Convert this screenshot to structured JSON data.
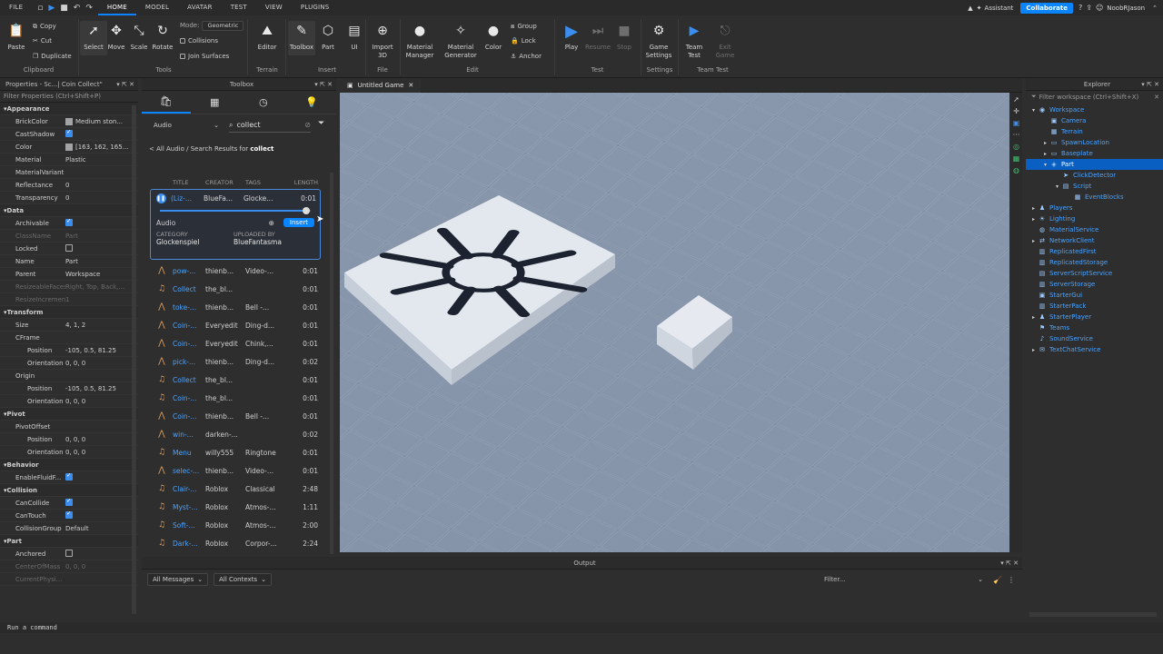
{
  "menu": {
    "file": "FILE",
    "tabs": [
      "HOME",
      "MODEL",
      "AVATAR",
      "TEST",
      "VIEW",
      "PLUGINS"
    ],
    "assistant": "Assistant",
    "collaborate": "Collaborate",
    "user": "NoobRJason"
  },
  "ribbon": {
    "paste": "Paste",
    "copy": "Copy",
    "cut": "Cut",
    "duplicate": "Duplicate",
    "clipboard": "Clipboard",
    "select": "Select",
    "move": "Move",
    "scale": "Scale",
    "rotate": "Rotate",
    "mode_label": "Mode:",
    "mode_value": "Geometric",
    "collisions": "Collisions",
    "join_surfaces": "Join Surfaces",
    "tools": "Tools",
    "editor": "Editor",
    "toolbox": "Toolbox",
    "terrain": "Terrain",
    "part": "Part",
    "ui": "UI",
    "import3d_line1": "Import",
    "import3d_line2": "3D",
    "insert": "Insert",
    "file": "File",
    "material_manager_line1": "Material",
    "material_manager_line2": "Manager",
    "material_generator_line1": "Material",
    "material_generator_line2": "Generator",
    "color": "Color",
    "group": "Group",
    "lock": "Lock",
    "anchor": "Anchor",
    "edit": "Edit",
    "play": "Play",
    "resume": "Resume",
    "stop": "Stop",
    "test": "Test",
    "game_settings_line1": "Game",
    "game_settings_line2": "Settings",
    "settings": "Settings",
    "team_test_line1": "Team",
    "team_test_line2": "Test",
    "exit_game_line1": "Exit",
    "exit_game_line2": "Game",
    "team_test_group": "Team Test"
  },
  "properties": {
    "title": "Properties - Sc...| Coin Collect\"",
    "filter": "Filter Properties (Ctrl+Shift+P)",
    "rows": [
      {
        "type": "sec",
        "name": "Appearance"
      },
      {
        "name": "BrickColor",
        "value": "Medium ston...",
        "swatch": "#a3a2a5"
      },
      {
        "name": "CastShadow",
        "check": true
      },
      {
        "name": "Color",
        "value": "[163, 162, 165...",
        "swatch": "#a3a2a5"
      },
      {
        "name": "Material",
        "value": "Plastic"
      },
      {
        "name": "MaterialVariant",
        "value": ""
      },
      {
        "name": "Reflectance",
        "value": "0"
      },
      {
        "name": "Transparency",
        "value": "0"
      },
      {
        "type": "sec",
        "name": "Data"
      },
      {
        "name": "Archivable",
        "check": true
      },
      {
        "name": "ClassName",
        "value": "Part",
        "dim": true
      },
      {
        "name": "Locked",
        "check": false
      },
      {
        "name": "Name",
        "value": "Part"
      },
      {
        "name": "Parent",
        "value": "Workspace"
      },
      {
        "name": "ResizeableFaces",
        "value": "Right, Top, Back,...",
        "dim": true
      },
      {
        "name": "ResizeIncrement",
        "value": "1",
        "dim": true
      },
      {
        "type": "sec",
        "name": "Transform"
      },
      {
        "name": "Size",
        "value": "4, 1, 2"
      },
      {
        "name": "CFrame",
        "value": ""
      },
      {
        "name": "Position",
        "value": "-105, 0.5, 81.25",
        "sub": true
      },
      {
        "name": "Orientation",
        "value": "0, 0, 0",
        "sub": true
      },
      {
        "name": "Origin",
        "value": ""
      },
      {
        "name": "Position",
        "value": "-105, 0.5, 81.25",
        "sub": true
      },
      {
        "name": "Orientation",
        "value": "0, 0, 0",
        "sub": true
      },
      {
        "type": "sec",
        "name": "Pivot"
      },
      {
        "name": "PivotOffset",
        "value": ""
      },
      {
        "name": "Position",
        "value": "0, 0, 0",
        "sub": true
      },
      {
        "name": "Orientation",
        "value": "0, 0, 0",
        "sub": true
      },
      {
        "type": "sec",
        "name": "Behavior"
      },
      {
        "name": "EnableFluidF...",
        "check": true
      },
      {
        "type": "sec",
        "name": "Collision"
      },
      {
        "name": "CanCollide",
        "check": true
      },
      {
        "name": "CanTouch",
        "check": true
      },
      {
        "name": "CollisionGroup",
        "value": "Default"
      },
      {
        "type": "sec",
        "name": "Part"
      },
      {
        "name": "Anchored",
        "check": false
      },
      {
        "name": "CenterOfMass",
        "value": "0, 0, 0",
        "dim": true
      },
      {
        "name": "CurrentPhysi...",
        "value": "",
        "dim": true
      }
    ]
  },
  "toolbox": {
    "title": "Toolbox",
    "category": "Audio",
    "search": "collect",
    "breadcrumb_prefix": "< All Audio / Search Results for ",
    "breadcrumb_term": "collect",
    "columns": {
      "title": "TITLE",
      "creator": "CREATOR",
      "tags": "TAGS",
      "length": "LENGTH"
    },
    "selected": {
      "title": "(Liz-...",
      "creator": "BlueFa...",
      "tags": "Glocke...",
      "length": "0:01",
      "type": "Audio",
      "insert": "Insert",
      "category_label": "CATEGORY",
      "category_value": "Glockenspiel",
      "uploaded_label": "UPLOADED BY",
      "uploaded_value": "BlueFantasma"
    },
    "rows": [
      {
        "icon": "waveform",
        "title": "pow-...",
        "creator": "thienb...",
        "tags": "Video-...",
        "length": "0:01"
      },
      {
        "icon": "music",
        "title": "Collect",
        "creator": "the_bl...",
        "tags": "",
        "length": "0:01"
      },
      {
        "icon": "waveform",
        "title": "toke-...",
        "creator": "thienb...",
        "tags": "Bell -...",
        "length": "0:01"
      },
      {
        "icon": "waveform",
        "title": "Coin-...",
        "creator": "Everyedit",
        "tags": "Ding-d...",
        "length": "0:01"
      },
      {
        "icon": "waveform",
        "title": "Coin-...",
        "creator": "Everyedit",
        "tags": "Chink,...",
        "length": "0:01"
      },
      {
        "icon": "waveform",
        "title": "pick-...",
        "creator": "thienb...",
        "tags": "Ding-d...",
        "length": "0:02"
      },
      {
        "icon": "music",
        "title": "Collect",
        "creator": "the_bl...",
        "tags": "",
        "length": "0:01"
      },
      {
        "icon": "music",
        "title": "Coin-...",
        "creator": "the_bl...",
        "tags": "",
        "length": "0:01"
      },
      {
        "icon": "waveform",
        "title": "Coin-...",
        "creator": "thienb...",
        "tags": "Bell -...",
        "length": "0:01"
      },
      {
        "icon": "waveform",
        "title": "win-...",
        "creator": "darken-...",
        "tags": "",
        "length": "0:02"
      },
      {
        "icon": "music",
        "title": "Menu",
        "creator": "willy555",
        "tags": "Ringtone",
        "length": "0:01"
      },
      {
        "icon": "waveform",
        "title": "selec-...",
        "creator": "thienb...",
        "tags": "Video-...",
        "length": "0:01"
      },
      {
        "icon": "music",
        "title": "Clair-...",
        "creator": "Roblox",
        "tags": "Classical",
        "length": "2:48"
      },
      {
        "icon": "music",
        "title": "Myst-...",
        "creator": "Roblox",
        "tags": "Atmos-...",
        "length": "1:11"
      },
      {
        "icon": "music",
        "title": "Soft-...",
        "creator": "Roblox",
        "tags": "Atmos-...",
        "length": "2:00"
      },
      {
        "icon": "music",
        "title": "Dark-...",
        "creator": "Roblox",
        "tags": "Corpor-...",
        "length": "2:24"
      }
    ]
  },
  "viewport": {
    "tab": "Untitled Game"
  },
  "explorer": {
    "title": "Explorer",
    "filter": "Filter workspace (Ctrl+Shift+X)",
    "items": [
      {
        "label": "Workspace",
        "depth": 0,
        "arrow": "▾",
        "icon": "◉"
      },
      {
        "label": "Camera",
        "depth": 1,
        "arrow": "",
        "icon": "▣"
      },
      {
        "label": "Terrain",
        "depth": 1,
        "arrow": "",
        "icon": "▦"
      },
      {
        "label": "SpawnLocation",
        "depth": 1,
        "arrow": "▸",
        "icon": "▭"
      },
      {
        "label": "Baseplate",
        "depth": 1,
        "arrow": "▸",
        "icon": "▭"
      },
      {
        "label": "Part",
        "depth": 1,
        "arrow": "▾",
        "icon": "◈",
        "selected": true
      },
      {
        "label": "ClickDetector",
        "depth": 2,
        "arrow": "",
        "icon": "➤"
      },
      {
        "label": "Script",
        "depth": 2,
        "arrow": "▾",
        "icon": "▤"
      },
      {
        "label": "EventBlocks",
        "depth": 3,
        "arrow": "",
        "icon": "▦"
      },
      {
        "label": "Players",
        "depth": 0,
        "arrow": "▸",
        "icon": "♟"
      },
      {
        "label": "Lighting",
        "depth": 0,
        "arrow": "▸",
        "icon": "☀"
      },
      {
        "label": "MaterialService",
        "depth": 0,
        "arrow": "",
        "icon": "◍"
      },
      {
        "label": "NetworkClient",
        "depth": 0,
        "arrow": "▸",
        "icon": "⇄"
      },
      {
        "label": "ReplicatedFirst",
        "depth": 0,
        "arrow": "",
        "icon": "▥"
      },
      {
        "label": "ReplicatedStorage",
        "depth": 0,
        "arrow": "",
        "icon": "▥"
      },
      {
        "label": "ServerScriptService",
        "depth": 0,
        "arrow": "",
        "icon": "▤"
      },
      {
        "label": "ServerStorage",
        "depth": 0,
        "arrow": "",
        "icon": "▥"
      },
      {
        "label": "StarterGui",
        "depth": 0,
        "arrow": "",
        "icon": "▣"
      },
      {
        "label": "StarterPack",
        "depth": 0,
        "arrow": "",
        "icon": "▥"
      },
      {
        "label": "StarterPlayer",
        "depth": 0,
        "arrow": "▸",
        "icon": "♟"
      },
      {
        "label": "Teams",
        "depth": 0,
        "arrow": "",
        "icon": "⚑"
      },
      {
        "label": "SoundService",
        "depth": 0,
        "arrow": "",
        "icon": "♪"
      },
      {
        "label": "TextChatService",
        "depth": 0,
        "arrow": "▸",
        "icon": "✉"
      }
    ]
  },
  "output": {
    "title": "Output",
    "messages": "All Messages",
    "contexts": "All Contexts",
    "filter": "Filter..."
  },
  "command": {
    "placeholder": "Run a command"
  },
  "colors": {
    "accent": "#0a84ff",
    "selection": "#0a5fc2",
    "link": "#4aa3ff"
  }
}
